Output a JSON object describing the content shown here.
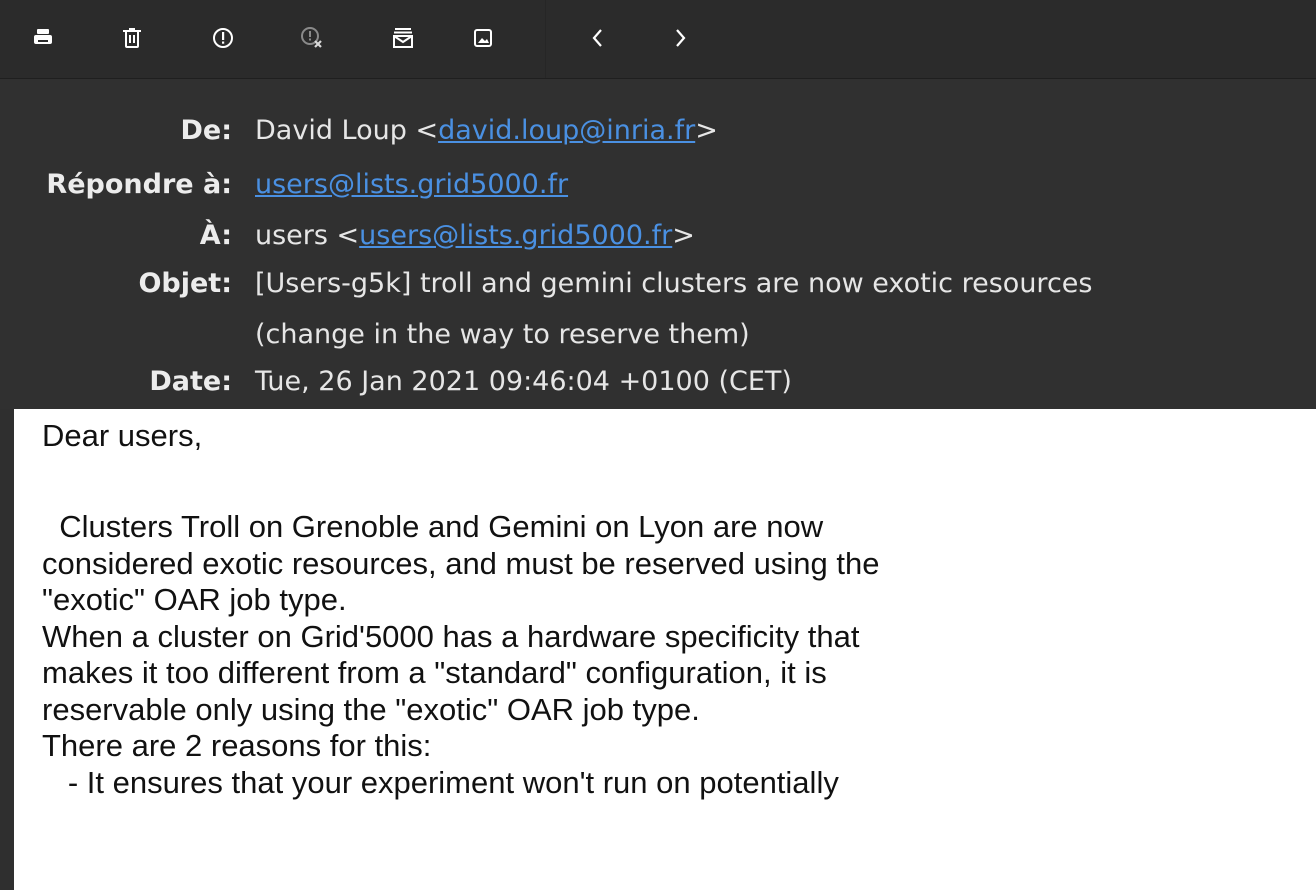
{
  "toolbar": {
    "buttons": [
      {
        "icon": "print-icon",
        "label": "Print"
      },
      {
        "icon": "trash-icon",
        "label": "Delete"
      },
      {
        "icon": "junk-icon",
        "label": "Mark as junk"
      },
      {
        "icon": "not-junk-icon",
        "label": "Mark as not junk"
      },
      {
        "icon": "archive-icon",
        "label": "Archive"
      },
      {
        "icon": "image-icon",
        "label": "Load images"
      },
      {
        "icon": "chevron-left-icon",
        "label": "Previous"
      },
      {
        "icon": "chevron-right-icon",
        "label": "Next"
      }
    ]
  },
  "header": {
    "from_label": "De:",
    "from_name": "David Loup <",
    "from_email": "david.loup@inria.fr",
    "from_close": ">",
    "reply_label": "Répondre à:",
    "reply_email": "users@lists.grid5000.fr",
    "to_label": "À:",
    "to_name": "users <",
    "to_email": "users@lists.grid5000.fr",
    "to_close": ">",
    "subject_label": "Objet:",
    "subject_line1": "[Users-g5k] troll and gemini clusters are now exotic resources",
    "subject_line2": "(change in the way to reserve them)",
    "date_label": "Date:",
    "date_value": "Tue, 26 Jan 2021 09:46:04 +0100 (CET)"
  },
  "body_lines": [
    "Dear users,",
    "",
    "  Clusters Troll on Grenoble and Gemini on Lyon are now",
    "considered exotic resources, and must be reserved using the",
    "\"exotic\" OAR job type.",
    "When a cluster on Grid'5000 has a hardware specificity that",
    "makes it too different from a \"standard\" configuration, it is",
    "reservable only using the \"exotic\" OAR job type.",
    "There are 2 reasons for this:",
    "   - It ensures that your experiment won't run on potentially"
  ],
  "colors": {
    "toolbar_bg": "#2b2b2b",
    "header_bg": "#303030",
    "link": "#4a90e2",
    "body_bg": "#ffffff"
  }
}
